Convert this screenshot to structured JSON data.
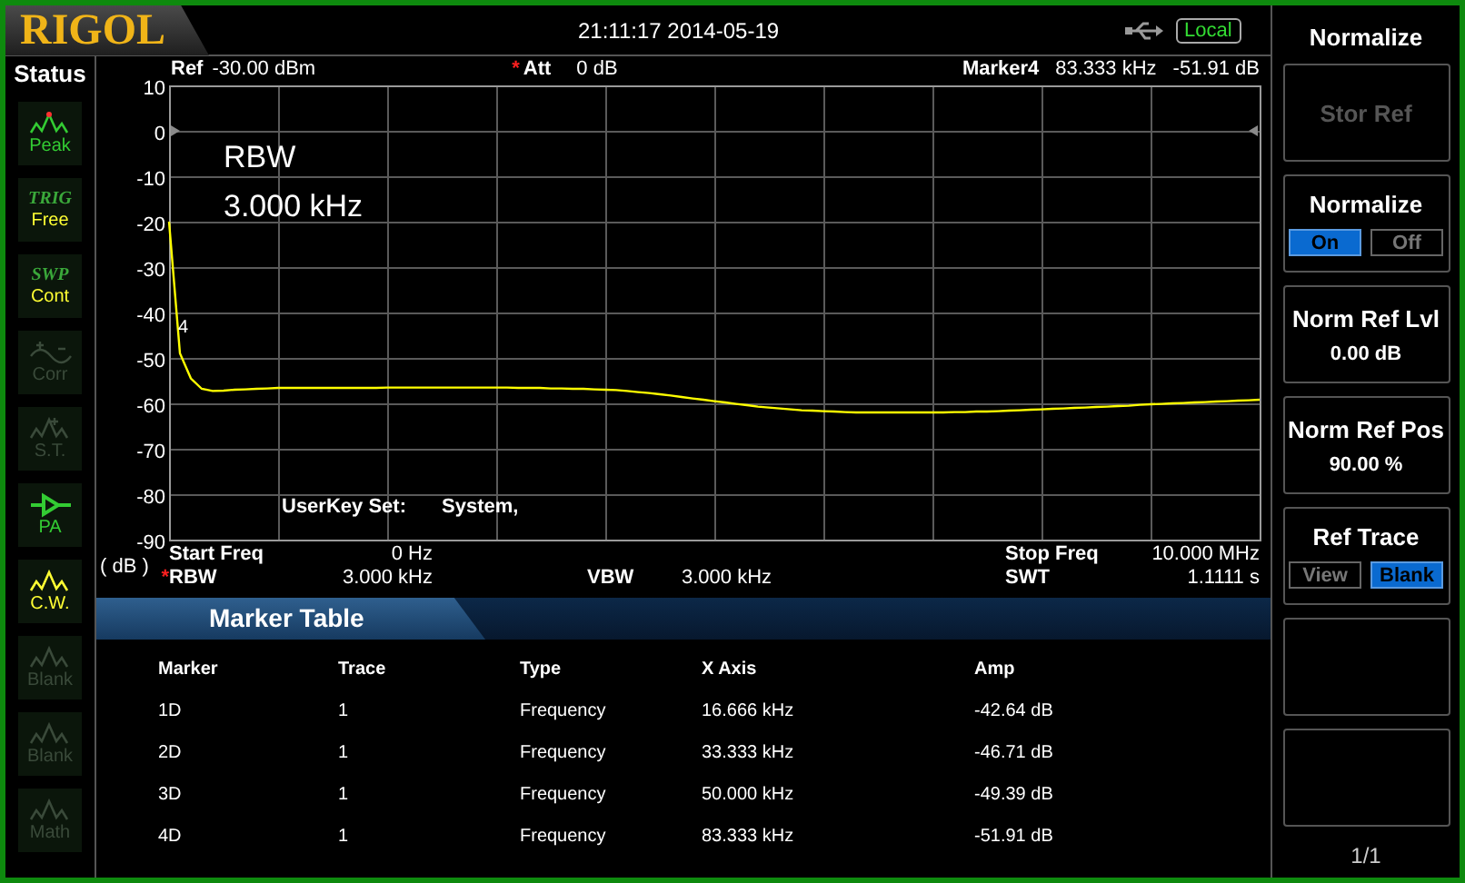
{
  "header": {
    "logo": "RIGOL",
    "datetime": "21:11:17 2014-05-19",
    "remote": "Local"
  },
  "status": {
    "title": "Status",
    "items": [
      {
        "kind": "peak",
        "label": "Peak",
        "active": true,
        "color": "#33cc33"
      },
      {
        "kind": "text",
        "title": "TRIG",
        "label": "Free",
        "active": true,
        "color": "#ffff33"
      },
      {
        "kind": "text",
        "title": "SWP",
        "label": "Cont",
        "active": true,
        "color": "#ffff33"
      },
      {
        "kind": "corr",
        "label": "Corr",
        "active": false
      },
      {
        "kind": "st",
        "label": "S.T.",
        "active": false
      },
      {
        "kind": "pa",
        "label": "PA",
        "active": true,
        "color": "#33cc33"
      },
      {
        "kind": "wave",
        "label": "C.W.",
        "active": true,
        "color": "#ffff33"
      },
      {
        "kind": "wave",
        "label": "Blank",
        "active": false
      },
      {
        "kind": "wave",
        "label": "Blank",
        "active": false
      },
      {
        "kind": "wave",
        "label": "Math",
        "active": false
      }
    ]
  },
  "display": {
    "ref": {
      "label": "Ref",
      "value": "-30.00 dBm"
    },
    "att": {
      "mark": "*",
      "label": "Att",
      "value": "0 dB"
    },
    "marker": {
      "label": "Marker4",
      "x": "83.333 kHz",
      "y": "-51.91 dB"
    },
    "overlay": [
      "RBW",
      "3.000 kHz"
    ],
    "marker_flag": "4",
    "userkey": {
      "label": "UserKey Set:",
      "value": "System,"
    },
    "unit": "( dB )",
    "chart_data": {
      "type": "line",
      "grid": true,
      "ylim": [
        -90,
        10
      ],
      "yticks": [
        10,
        0,
        -10,
        -20,
        -30,
        -40,
        -50,
        -60,
        -70,
        -80,
        -90
      ],
      "categories": [
        null,
        null,
        null,
        null,
        null,
        null,
        null,
        null,
        null,
        null,
        null,
        null,
        null,
        null,
        null,
        null,
        null,
        null,
        null,
        null,
        null,
        null,
        null,
        null,
        null,
        null,
        null,
        null,
        null,
        null,
        null,
        null,
        null,
        null,
        null,
        null,
        null,
        null,
        null,
        null,
        null,
        null,
        null,
        null,
        null,
        null,
        null,
        null,
        null,
        null,
        null,
        null,
        null,
        null,
        null,
        null,
        null,
        null,
        null,
        null,
        null,
        null,
        null,
        null,
        null,
        null,
        null,
        null,
        null,
        null,
        null,
        null,
        null,
        null,
        null,
        null,
        null,
        null,
        null,
        null,
        null,
        null,
        null,
        null,
        null,
        null,
        null,
        null,
        null,
        null,
        null,
        null,
        null,
        null,
        null,
        null,
        null,
        null,
        null,
        null,
        null
      ],
      "series": [
        {
          "color": "#ffff00",
          "values": [
            -20,
            -49,
            -54.5,
            -56.8,
            -57.3,
            -57.2,
            -57,
            -56.9,
            -56.8,
            -56.7,
            -56.6,
            -56.6,
            -56.6,
            -56.6,
            -56.6,
            -56.6,
            -56.6,
            -56.6,
            -56.6,
            -56.6,
            -56.5,
            -56.5,
            -56.5,
            -56.5,
            -56.5,
            -56.5,
            -56.5,
            -56.5,
            -56.5,
            -56.5,
            -56.5,
            -56.5,
            -56.6,
            -56.6,
            -56.6,
            -56.7,
            -56.7,
            -56.8,
            -56.8,
            -56.9,
            -57,
            -57.1,
            -57.3,
            -57.5,
            -57.7,
            -58,
            -58.3,
            -58.6,
            -58.9,
            -59.2,
            -59.5,
            -59.8,
            -60.1,
            -60.4,
            -60.7,
            -60.9,
            -61.1,
            -61.3,
            -61.5,
            -61.6,
            -61.7,
            -61.8,
            -61.9,
            -62,
            -62,
            -62,
            -62,
            -62,
            -62,
            -62,
            -62,
            -62,
            -61.9,
            -61.9,
            -61.8,
            -61.8,
            -61.7,
            -61.6,
            -61.5,
            -61.4,
            -61.3,
            -61.2,
            -61.1,
            -61,
            -60.9,
            -60.8,
            -60.7,
            -60.6,
            -60.5,
            -60.3,
            -60.2,
            -60.1,
            -60,
            -59.9,
            -59.8,
            -59.7,
            -59.6,
            -59.5,
            -59.4,
            -59.3,
            -59.2
          ]
        }
      ]
    },
    "sweep": {
      "start": {
        "label": "Start Freq",
        "value": "0 Hz"
      },
      "stop": {
        "label": "Stop Freq",
        "value": "10.000 MHz"
      },
      "rbw": {
        "mark": "*",
        "label": "RBW",
        "value": "3.000 kHz"
      },
      "vbw": {
        "label": "VBW",
        "value": "3.000 kHz"
      },
      "swt": {
        "label": "SWT",
        "value": "1.1111 s"
      }
    }
  },
  "marker_table": {
    "title": "Marker Table",
    "columns": [
      "Marker",
      "Trace",
      "Type",
      "X Axis",
      "Amp"
    ],
    "rows": [
      [
        "1D",
        "1",
        "Frequency",
        "16.666 kHz",
        "-42.64 dB"
      ],
      [
        "2D",
        "1",
        "Frequency",
        "33.333 kHz",
        "-46.71 dB"
      ],
      [
        "3D",
        "1",
        "Frequency",
        "50.000 kHz",
        "-49.39 dB"
      ],
      [
        "4D",
        "1",
        "Frequency",
        "83.333 kHz",
        "-51.91 dB"
      ]
    ]
  },
  "softkeys": {
    "title": "Normalize",
    "page": "1/1",
    "keys": [
      {
        "kind": "plain",
        "label": "Stor Ref",
        "disabled": true
      },
      {
        "kind": "toggle",
        "label": "Normalize",
        "disabled": false,
        "options": [
          {
            "label": "On",
            "selected": true
          },
          {
            "label": "Off",
            "selected": false
          }
        ]
      },
      {
        "kind": "value",
        "label": "Norm Ref Lvl",
        "value": "0.00 dB",
        "disabled": false
      },
      {
        "kind": "value",
        "label": "Norm Ref Pos",
        "value": "90.00 %",
        "disabled": false
      },
      {
        "kind": "toggle",
        "label": "Ref Trace",
        "disabled": false,
        "options": [
          {
            "label": "View",
            "selected": false
          },
          {
            "label": "Blank",
            "selected": true
          }
        ]
      },
      {
        "kind": "empty"
      },
      {
        "kind": "empty"
      }
    ]
  }
}
